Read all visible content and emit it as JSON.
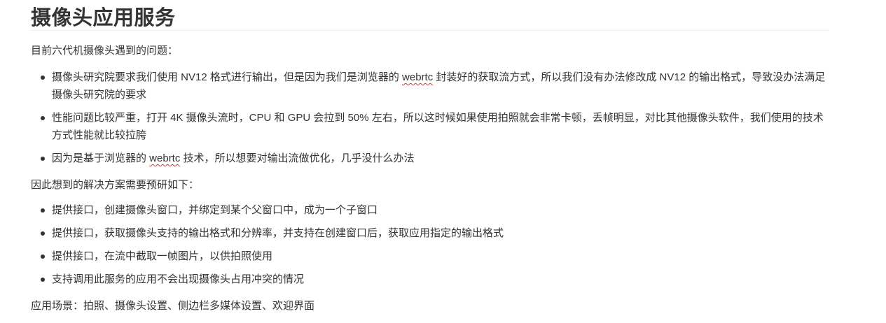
{
  "title": "摄像头应用服务",
  "intro": "目前六代机摄像头遇到的问题：",
  "problems": [
    {
      "before": "摄像头研究院要求我们使用 NV12 格式进行输出，但是因为我们是浏览器的 ",
      "flagged": "webrtc",
      "after": " 封装好的获取流方式，所以我们没有办法修改成 NV12 的输出格式，导致没办法满足摄像头研究院的要求"
    },
    {
      "before": "性能问题比较严重，打开 4K 摄像头流时，CPU 和 GPU 会拉到 50% 左右，所以这时候如果使用拍照就会非常卡顿，丢帧明显，对比其他摄像头软件，我们使用的技术方式性能就比较拉胯",
      "flagged": "",
      "after": ""
    },
    {
      "before": "因为是基于浏览器的 ",
      "flagged": "webrtc",
      "after": " 技术，所以想要对输出流做优化，几乎没什么办法"
    }
  ],
  "solution_intro": "因此想到的解决方案需要预研如下：",
  "solutions": [
    "提供接口，创建摄像头窗口，并绑定到某个父窗口中，成为一个子窗口",
    "提供接口，获取摄像头支持的输出格式和分辨率，并支持在创建窗口后，获取应用指定的输出格式",
    "提供接口，在流中截取一帧图片，以供拍照使用",
    "支持调用此服务的应用不会出现摄像头占用冲突的情况"
  ],
  "scenarios": "应用场景：拍照、摄像头设置、侧边栏多媒体设置、欢迎界面",
  "colors": {
    "text": "#333333",
    "rule": "#eeeeee",
    "spellcheck_underline": "#e03030"
  }
}
